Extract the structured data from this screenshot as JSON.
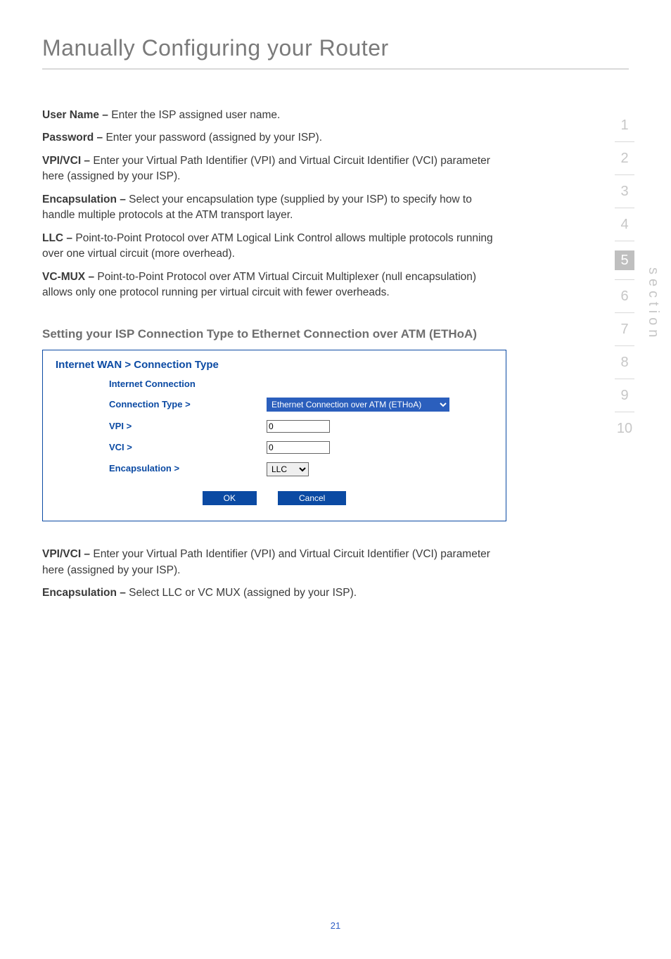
{
  "header": {
    "title": "Manually Configuring your Router"
  },
  "body": {
    "p1_label": "User Name – ",
    "p1_text": "Enter the ISP assigned user name.",
    "p2_label": "Password – ",
    "p2_text": "Enter your password (assigned by your ISP).",
    "p3_label": "VPI/VCI – ",
    "p3_text": "Enter your Virtual Path Identifier (VPI) and Virtual Circuit Identifier (VCI) parameter here (assigned by your ISP).",
    "p4_label": "Encapsulation – ",
    "p4_text": "Select your encapsulation type (supplied by your ISP) to specify how to handle multiple protocols at the ATM transport layer.",
    "p5_label": "LLC – ",
    "p5_text": "Point-to-Point Protocol over ATM Logical Link Control allows multiple protocols running over one virtual circuit (more overhead).",
    "p6_label": "VC-MUX – ",
    "p6_text": "Point-to-Point Protocol over ATM Virtual Circuit Multiplexer (null encapsulation) allows only one protocol running per virtual circuit with fewer overheads."
  },
  "subheading": "Setting your ISP Connection Type to Ethernet Connection over ATM (ETHoA)",
  "panel": {
    "title": "Internet WAN > Connection Type",
    "section_label": "Internet Connection",
    "rows": {
      "conn_label": "Connection Type >",
      "conn_value": "Ethernet Connection over ATM (ETHoA)",
      "vpi_label": "VPI >",
      "vpi_value": "0",
      "vci_label": "VCI >",
      "vci_value": "0",
      "enc_label": "Encapsulation >",
      "enc_value": "LLC"
    },
    "actions": {
      "ok": "OK",
      "cancel": "Cancel"
    }
  },
  "lower": {
    "p1_label": "VPI/VCI – ",
    "p1_text": "Enter your Virtual Path Identifier (VPI) and Virtual Circuit Identifier (VCI) parameter here (assigned by your ISP).",
    "p2_label": "Encapsulation – ",
    "p2_text": "Select LLC or VC MUX (assigned by your ISP)."
  },
  "side": {
    "items": [
      "1",
      "2",
      "3",
      "4",
      "5",
      "6",
      "7",
      "8",
      "9",
      "10"
    ],
    "active_index": 4,
    "label": "section"
  },
  "page_number": "21"
}
